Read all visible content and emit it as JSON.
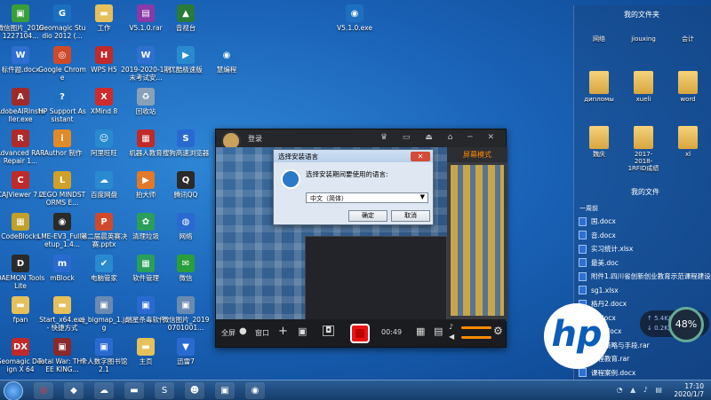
{
  "desktop_icons": [
    {
      "label": "微信图片_2019122710​4...",
      "color": "#3a9e3a",
      "glyph": "▣"
    },
    {
      "label": "Geomagic Studio 2012 (...",
      "color": "#1a6fc0",
      "glyph": "G"
    },
    {
      "label": "工作",
      "color": "#e6c05a",
      "glyph": "▬"
    },
    {
      "label": "V5.1.0.rar",
      "color": "#8a3aa8",
      "glyph": "▤"
    },
    {
      "label": "音视台",
      "color": "#2a7a3a",
      "glyph": "▲"
    },
    {
      "label": "V5.1.0.exe",
      "color": "#1f6fc0",
      "glyph": "◉"
    },
    {
      "label": "标件题.docx",
      "color": "#2e6fd0",
      "glyph": "W"
    },
    {
      "label": "Google Chrome",
      "color": "#d04a2a",
      "glyph": "◎"
    },
    {
      "label": "WPS H5",
      "color": "#c02a2a",
      "glyph": "H"
    },
    {
      "label": "2019-2020-1期末考试安...",
      "color": "#2e6fd0",
      "glyph": "W"
    },
    {
      "label": "优酷极速版",
      "color": "#2a8ad0",
      "glyph": "▶"
    },
    {
      "label": "慧编程",
      "color": "#1f6fc0",
      "glyph": "◉"
    },
    {
      "label": "AdobeAIRInstaller.exe",
      "color": "#a02a2a",
      "glyph": "A"
    },
    {
      "label": "HP Support Assistant",
      "color": "#1f6fc0",
      "glyph": "?"
    },
    {
      "label": "XMind 8",
      "color": "#d02a2a",
      "glyph": "X"
    },
    {
      "label": "回收站",
      "color": "#8aa0b8",
      "glyph": "♻"
    },
    {
      "label": "Advanced RAR Repair 1...",
      "color": "#b02a2a",
      "glyph": "R"
    },
    {
      "label": "iAuthor 制作",
      "color": "#e08a2a",
      "glyph": "i"
    },
    {
      "label": "阿里旺旺",
      "color": "#2a8ad0",
      "glyph": "☺"
    },
    {
      "label": "机器人教育",
      "color": "#c02a2a",
      "glyph": "▦"
    },
    {
      "label": "搜狗高速浏览器",
      "color": "#2a6ad0",
      "glyph": "S"
    },
    {
      "label": "CAJViewer 7.2",
      "color": "#c02a2a",
      "glyph": "C"
    },
    {
      "label": "LEGO MINDSTORMS E...",
      "color": "#d0a02a",
      "glyph": "L"
    },
    {
      "label": "百度网盘",
      "color": "#2a8ad0",
      "glyph": "☁"
    },
    {
      "label": "拍大师",
      "color": "#e07a2a",
      "glyph": "▶"
    },
    {
      "label": "腾讯QQ",
      "color": "#2a2a2a",
      "glyph": "Q"
    },
    {
      "label": "CodeBlocks",
      "color": "#c0a02a",
      "glyph": "▦"
    },
    {
      "label": "LME-EV3_Full-setup_1.4...",
      "color": "#2a2a2a",
      "glyph": "◉"
    },
    {
      "label": "第二届晨英赛决赛.pptx",
      "color": "#d04a2a",
      "glyph": "P"
    },
    {
      "label": "清理垃圾",
      "color": "#2a9e5a",
      "glyph": "✿"
    },
    {
      "label": "网络",
      "color": "#2a6ad0",
      "glyph": "◍"
    },
    {
      "label": "DAEMON Tools Lite",
      "color": "#2a2a2a",
      "glyph": "D"
    },
    {
      "label": "mBlock",
      "color": "#2a6ad0",
      "glyph": "m"
    },
    {
      "label": "电脑管家",
      "color": "#2a8ad0",
      "glyph": "✔"
    },
    {
      "label": "软件管理",
      "color": "#2a9e5a",
      "glyph": "▦"
    },
    {
      "label": "微信",
      "color": "#2a9e3a",
      "glyph": "✉"
    },
    {
      "label": "fpan",
      "color": "#e6c05a",
      "glyph": "▬"
    },
    {
      "label": "Start_x64.exe - 快捷方式",
      "color": "#e6c05a",
      "glyph": "▬"
    },
    {
      "label": "zj_bigmap_1.jpg",
      "color": "#6a8ab0",
      "glyph": "▣"
    },
    {
      "label": "瑞星杀毒软件",
      "color": "#2a6ad0",
      "glyph": "▣"
    },
    {
      "label": "微信图片_2019070100​1...",
      "color": "#6a8ab0",
      "glyph": "▣"
    },
    {
      "label": "Geomagic Design X 64",
      "color": "#c02a2a",
      "glyph": "DX"
    },
    {
      "label": "Total War: THREE KING...",
      "color": "#8a2a2a",
      "glyph": "▣"
    },
    {
      "label": "个人数字图书馆2.1",
      "color": "#2a6ad0",
      "glyph": "▣"
    },
    {
      "label": "主页",
      "color": "#e6c05a",
      "glyph": "▬"
    },
    {
      "label": "迅雷7",
      "color": "#2a6ad0",
      "glyph": "▼"
    }
  ],
  "recorder": {
    "login_label": "登录",
    "mode_label": "屏幕模式",
    "fullscreen_label": "全屏",
    "window_label": "窗口",
    "timer": "00:49"
  },
  "dialog": {
    "title": "选择安装语言",
    "prompt": "选择安装期间要使用的语言:",
    "selected_language": "中文（简体）",
    "ok_label": "确定",
    "cancel_label": "取消"
  },
  "explorer": {
    "header_top": "我的文件夹",
    "folders": [
      {
        "label": "网络"
      },
      {
        "label": "jiouxing"
      },
      {
        "label": "会计"
      },
      {
        "label": "дипломы"
      },
      {
        "label": "xueli"
      },
      {
        "label": "word"
      },
      {
        "label": "魏庆"
      },
      {
        "label": "2017-2018-1RFID成绩"
      },
      {
        "label": "xl"
      }
    ],
    "header_files": "我的文件",
    "subhead": "一周前",
    "files": [
      "国.docx",
      "音.docx",
      "实习统计.xlsx",
      "最美.doc",
      "附件1.四川省创新创业教育示范课程建设...",
      "sg1.xlsx",
      "格丹2.docx",
      "丹.docx",
      "dan.docx",
      "教学策略与手段.rar",
      "课程教育.rar",
      "课程案例.docx"
    ]
  },
  "overlay": {
    "upload": "5.4K/s",
    "download": "0.2K/s",
    "gauge": "48%",
    "hp_logo": "hp"
  },
  "taskbar": {
    "time": "17:10",
    "date": "2020/1/7"
  }
}
